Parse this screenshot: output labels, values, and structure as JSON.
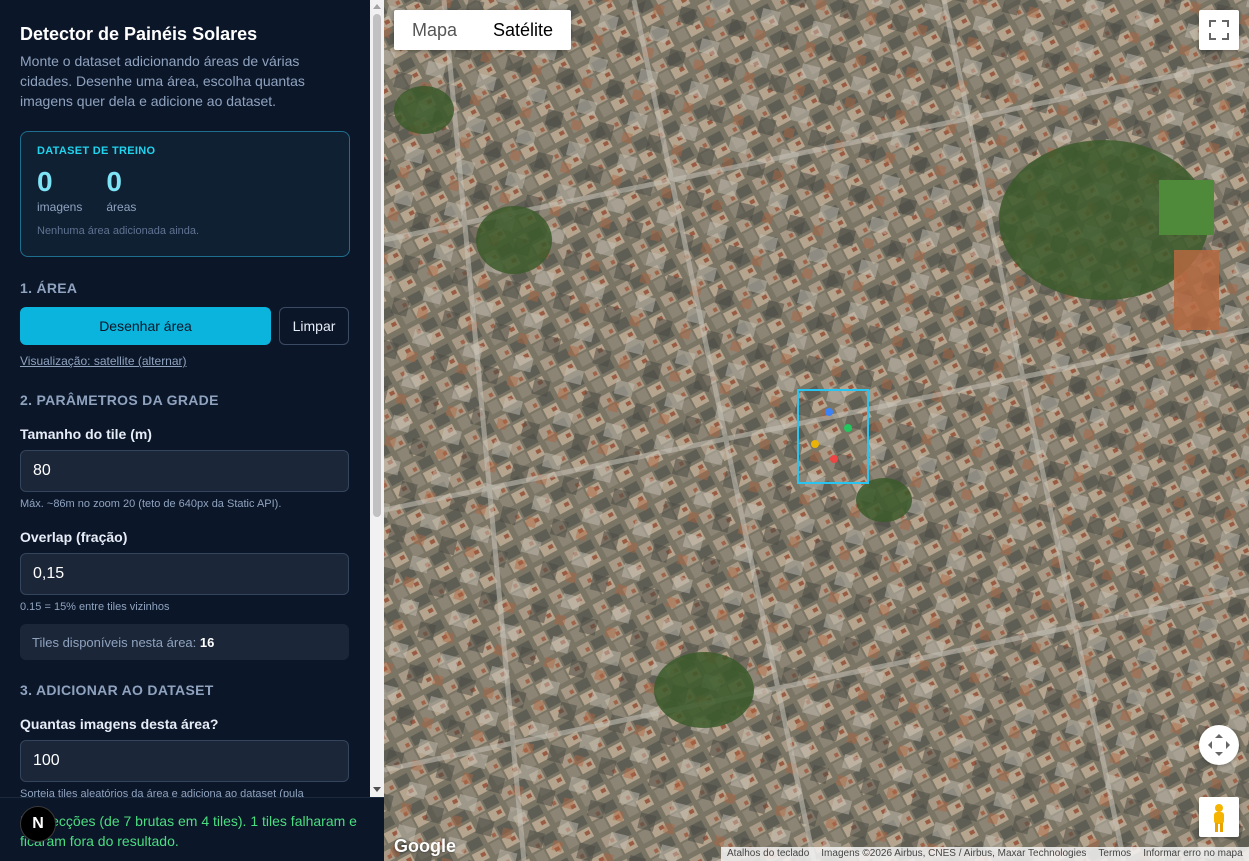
{
  "sidebar": {
    "title": "Detector de Painéis Solares",
    "intro": "Monte o dataset adicionando áreas de várias cidades. Desenhe uma área, escolha quantas imagens quer dela e adicione ao dataset.",
    "dataset": {
      "heading": "DATASET DE TREINO",
      "images_count": "0",
      "images_label": "imagens",
      "areas_count": "0",
      "areas_label": "áreas",
      "empty_text": "Nenhuma área adicionada ainda."
    },
    "area": {
      "heading": "1. ÁREA",
      "draw_button": "Desenhar área",
      "clear_button": "Limpar",
      "view_link": "Visualização: satellite (alternar)"
    },
    "grid": {
      "heading": "2. PARÂMETROS DA GRADE",
      "tile_size_label": "Tamanho do tile (m)",
      "tile_size_value": "80",
      "tile_size_hint": "Máx. ~86m no zoom 20 (teto de 640px da Static API).",
      "overlap_label": "Overlap (fração)",
      "overlap_value": "0,15",
      "overlap_hint": "0.15 = 15% entre tiles vizinhos",
      "tiles_available_label": "Tiles disponíveis nesta área:",
      "tiles_available_value": "16"
    },
    "add": {
      "heading": "3. ADICIONAR AO DATASET",
      "count_label": "Quantas imagens desta área?",
      "count_value": "100",
      "count_hint": "Sorteia tiles aleatórios da área e adiciona ao dataset (pula"
    },
    "status_text": "5 detecções (de 7 brutas em 4 tiles). 1 tiles falharam e ficaram fora do resultado.",
    "badge": "N"
  },
  "map": {
    "tabs": [
      {
        "label": "Mapa",
        "active": false
      },
      {
        "label": "Satélite",
        "active": true
      }
    ],
    "google_logo": "Google",
    "attribution": [
      "Atalhos do teclado",
      "Imagens ©2026 Airbus, CNES / Airbus, Maxar Technologies",
      "Termos",
      "Informar erro no mapa"
    ],
    "markers": [
      {
        "color": "#3b82f6"
      },
      {
        "color": "#22c55e"
      },
      {
        "color": "#eab308"
      },
      {
        "color": "#ef4444"
      }
    ]
  },
  "icons": {
    "fullscreen": "fullscreen-icon",
    "recenter": "recenter-icon",
    "pegman": "pegman-icon"
  }
}
